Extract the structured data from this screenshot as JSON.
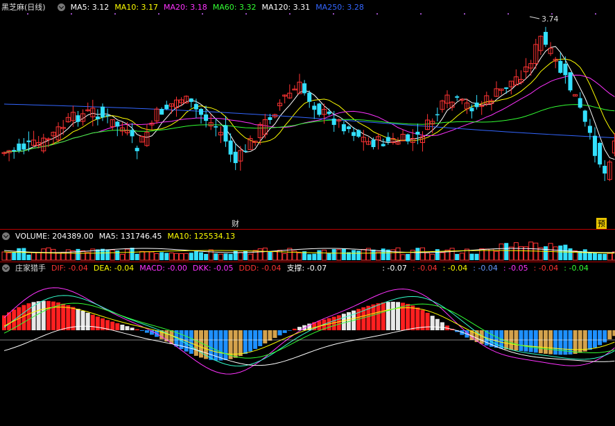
{
  "price_panel": {
    "title": "黑芝麻(日线)",
    "ma": [
      {
        "label": "MA5: 3.12",
        "color": "#ffffff"
      },
      {
        "label": "MA10: 3.17",
        "color": "#ffff00"
      },
      {
        "label": "MA20: 3.18",
        "color": "#ff33ff"
      },
      {
        "label": "MA60: 3.32",
        "color": "#33ff33"
      },
      {
        "label": "MA120: 3.31",
        "color": "#ffffff"
      },
      {
        "label": "MA250: 3.28",
        "color": "#3366ff"
      }
    ],
    "high_marker": "3.74",
    "event_cai": "财",
    "event_yu": "预"
  },
  "volume_panel": {
    "label": "VOLUME: 204389.00",
    "ma5": "MA5: 131746.45",
    "ma10": "MA10: 125534.13"
  },
  "indicator_panel": {
    "name": "庄家猎手",
    "items": [
      {
        "label": "DIF: -0.04",
        "color": "#ff3333"
      },
      {
        "label": "DEA: -0.04",
        "color": "#ffff00"
      },
      {
        "label": "MACD: -0.00",
        "color": "#ff33ff"
      },
      {
        "label": "DKK: -0.05",
        "color": "#ff33ff"
      },
      {
        "label": "DDD: -0.04",
        "color": "#ff3333"
      },
      {
        "label": "支撑: -0.07",
        "color": "#ffffff"
      }
    ],
    "extra": [
      {
        "label": ": -0.07",
        "color": "#ffffff"
      },
      {
        "label": ": -0.04",
        "color": "#ff3333"
      },
      {
        "label": ": -0.04",
        "color": "#ffff00"
      },
      {
        "label": ": -0.04",
        "color": "#6699ff"
      },
      {
        "label": ": -0.05",
        "color": "#ff33ff"
      },
      {
        "label": ": -0.04",
        "color": "#ff3333"
      },
      {
        "label": ": -0.04",
        "color": "#33ff33"
      }
    ]
  },
  "colors": {
    "up": "#ff3333",
    "down": "#33e0ff",
    "separator": "#b00000"
  }
}
